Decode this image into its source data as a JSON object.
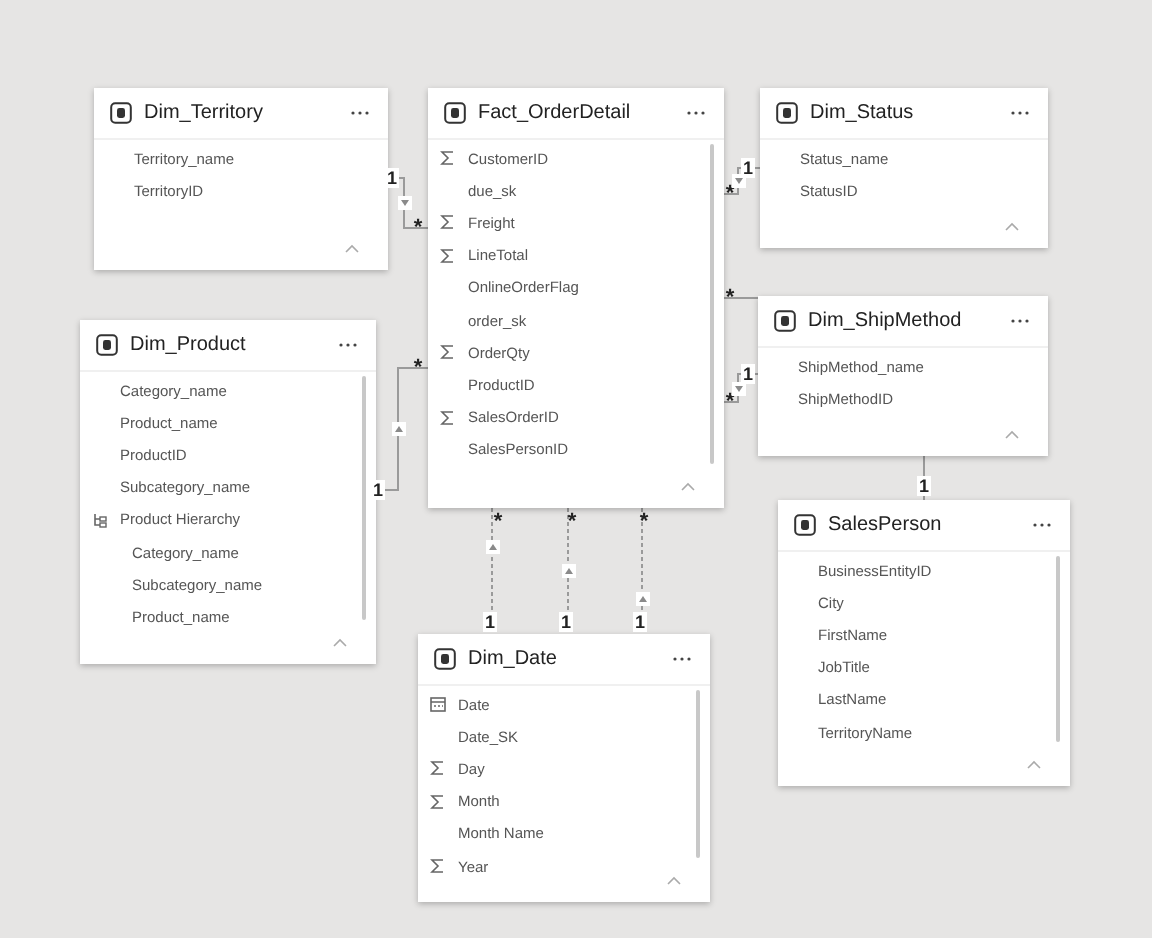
{
  "tables": [
    {
      "name": "Dim_Territory",
      "fields": [
        {
          "name": "Territory_name",
          "kind": "plain"
        },
        {
          "name": "TerritoryID",
          "kind": "plain"
        }
      ]
    },
    {
      "name": "Fact_OrderDetail",
      "fields": [
        {
          "name": "CustomerID",
          "kind": "sum"
        },
        {
          "name": "due_sk",
          "kind": "plain"
        },
        {
          "name": "Freight",
          "kind": "sum"
        },
        {
          "name": "LineTotal",
          "kind": "sum"
        },
        {
          "name": "OnlineOrderFlag",
          "kind": "plain"
        },
        {
          "name": "order_sk",
          "kind": "plain"
        },
        {
          "name": "OrderQty",
          "kind": "sum"
        },
        {
          "name": "ProductID",
          "kind": "plain"
        },
        {
          "name": "SalesOrderID",
          "kind": "sum"
        },
        {
          "name": "SalesPersonID",
          "kind": "plain"
        }
      ]
    },
    {
      "name": "Dim_Status",
      "fields": [
        {
          "name": "Status_name",
          "kind": "plain"
        },
        {
          "name": "StatusID",
          "kind": "plain"
        }
      ]
    },
    {
      "name": "Dim_ShipMethod",
      "fields": [
        {
          "name": "ShipMethod_name",
          "kind": "plain"
        },
        {
          "name": "ShipMethodID",
          "kind": "plain"
        }
      ]
    },
    {
      "name": "Dim_Product",
      "fields": [
        {
          "name": "Category_name",
          "kind": "plain"
        },
        {
          "name": "Product_name",
          "kind": "plain"
        },
        {
          "name": "ProductID",
          "kind": "plain"
        },
        {
          "name": "Subcategory_name",
          "kind": "plain"
        },
        {
          "name": "Product Hierarchy",
          "kind": "hierarchy",
          "children": [
            {
              "name": "Category_name"
            },
            {
              "name": "Subcategory_name"
            },
            {
              "name": "Product_name"
            }
          ]
        }
      ]
    },
    {
      "name": "Dim_Date",
      "fields": [
        {
          "name": "Date",
          "kind": "date"
        },
        {
          "name": "Date_SK",
          "kind": "plain"
        },
        {
          "name": "Day",
          "kind": "sum"
        },
        {
          "name": "Month",
          "kind": "sum"
        },
        {
          "name": "Month Name",
          "kind": "plain"
        },
        {
          "name": "Year",
          "kind": "sum"
        }
      ]
    },
    {
      "name": "SalesPerson",
      "fields": [
        {
          "name": "BusinessEntityID",
          "kind": "plain"
        },
        {
          "name": "City",
          "kind": "plain"
        },
        {
          "name": "FirstName",
          "kind": "plain"
        },
        {
          "name": "JobTitle",
          "kind": "plain"
        },
        {
          "name": "LastName",
          "kind": "plain"
        },
        {
          "name": "TerritoryName",
          "kind": "plain"
        }
      ]
    }
  ],
  "relationships": [
    {
      "one": "1",
      "many": "*"
    },
    {
      "one": "1",
      "many": "*"
    },
    {
      "one": "1",
      "many": "*"
    },
    {
      "one": "1",
      "many": "*"
    },
    {
      "one": "1",
      "many": "*"
    },
    {
      "one": "1",
      "many": "*"
    },
    {
      "one": "1",
      "many": "*"
    },
    {
      "one": "1",
      "many": "*"
    }
  ]
}
